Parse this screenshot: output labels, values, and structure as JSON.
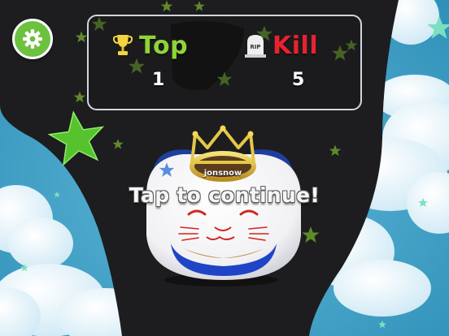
{
  "hud": {
    "settings": {
      "icon": "gear-icon"
    },
    "scoreboard": {
      "top": {
        "icon": "trophy-icon",
        "label": "Top",
        "value": "1",
        "color": "#8fd437"
      },
      "kill": {
        "icon": "tombstone-icon",
        "icon_text": "RIP",
        "label": "Kill",
        "value": "5",
        "color": "#e8232f"
      }
    }
  },
  "player": {
    "name": "jonsnow"
  },
  "prompt": {
    "text": "Tap to continue!"
  },
  "colors": {
    "sky": "#3fa3c8",
    "tower": "#1e1e1e",
    "accent_green": "#6cc13f"
  }
}
